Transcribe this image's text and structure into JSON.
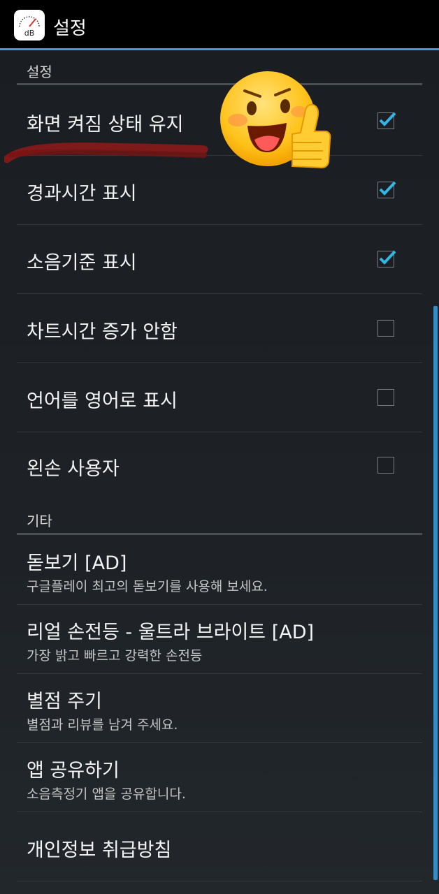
{
  "app_bar": {
    "icon_text": "dB",
    "title": "설정"
  },
  "sections": {
    "settings_header": "설정",
    "other_header": "기타"
  },
  "settings": [
    {
      "label": "화면 켜짐 상태 유지",
      "checked": true
    },
    {
      "label": "경과시간 표시",
      "checked": true
    },
    {
      "label": "소음기준 표시",
      "checked": true
    },
    {
      "label": "차트시간 증가 안함",
      "checked": false
    },
    {
      "label": "언어를 영어로 표시",
      "checked": false
    },
    {
      "label": "왼손 사용자",
      "checked": false
    }
  ],
  "others": [
    {
      "title": "돋보기 [AD]",
      "summary": "구글플레이 최고의 돋보기를 사용해 보세요."
    },
    {
      "title": "리얼 손전등 - 울트라 브라이트 [AD]",
      "summary": "가장 밝고 빠르고 강력한 손전등"
    },
    {
      "title": "별점 주기",
      "summary": "별점과 리뷰를 남겨 주세요."
    },
    {
      "title": "앱 공유하기",
      "summary": "소음측정기 앱을 공유합니다."
    },
    {
      "title": "개인정보 취급방침",
      "summary": ""
    }
  ],
  "colors": {
    "accent": "#3aa0d4",
    "check": "#33b5e5",
    "annotation_stroke": "#8b1a1a"
  }
}
